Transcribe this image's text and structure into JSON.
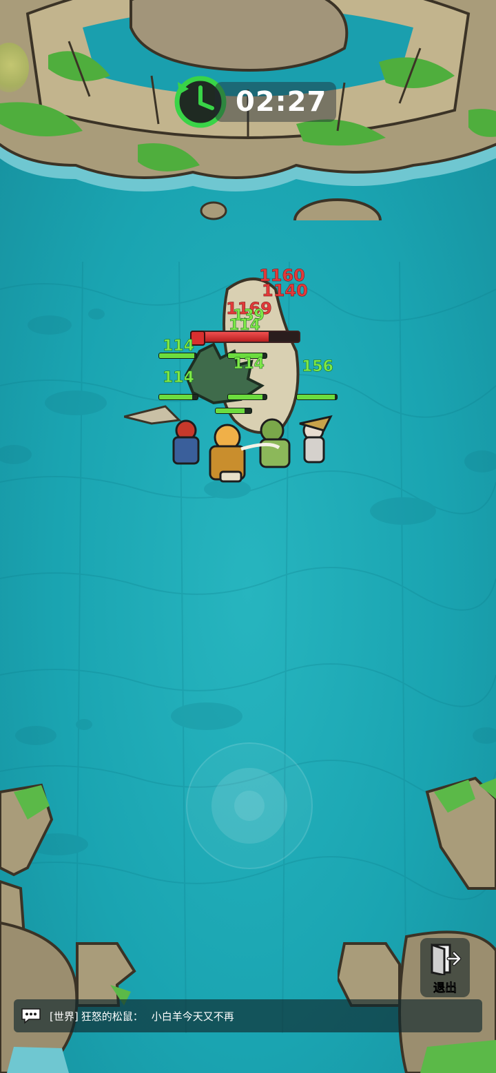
{
  "hud": {
    "timer": "02:27",
    "timer_icon": "clock-refresh-icon",
    "exit_label": "退出",
    "exit_icon": "exit-door-icon"
  },
  "chat": {
    "icon": "chat-bubble-icon",
    "channel": "[世界]",
    "sender": "狂怒的松鼠：",
    "message": "小白羊今天又不再"
  },
  "battle": {
    "heal_numbers": [
      "114",
      "114",
      "114",
      "114",
      "114",
      "139",
      "156"
    ],
    "damage_numbers": [
      "1160",
      "1140",
      "1169"
    ],
    "boss_hp_fraction": 0.72,
    "hero_hp_fractions": [
      0.95,
      0.9,
      0.85,
      0.9,
      0.95,
      0.8
    ],
    "colors": {
      "heal": "#7ee848",
      "damage": "#e23a3a",
      "timer_green": "#39d447"
    }
  }
}
